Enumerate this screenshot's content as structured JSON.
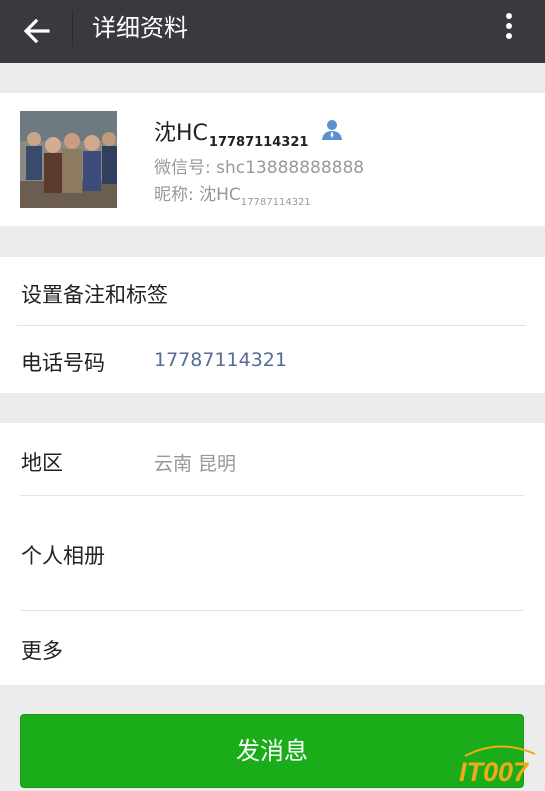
{
  "header": {
    "title": "详细资料",
    "back_icon": "arrow-left-icon",
    "more_icon": "more-vert-icon"
  },
  "profile": {
    "name": "沈HC",
    "name_suffix": "17787114321",
    "wechat_id_label": "微信号: ",
    "wechat_id": "shc13888888888",
    "nickname_label": "昵称: ",
    "nickname": "沈HC",
    "nickname_suffix": "17787114321",
    "contact_icon": "contact-person-icon"
  },
  "rows": {
    "remarks_label": "设置备注和标签",
    "phone_label": "电话号码",
    "phone_value": "17787114321",
    "region_label": "地区",
    "region_value": "云南  昆明",
    "album_label": "个人相册",
    "more_label": "更多"
  },
  "actions": {
    "send_message": "发消息"
  },
  "watermark": {
    "text": "IT007"
  },
  "colors": {
    "header_bg": "#393a3f",
    "accent_green": "#1aad19",
    "link_blue": "#576b95",
    "secondary_text": "#999999",
    "contact_icon": "#5a8fd0",
    "watermark_orange": "#f3a91c"
  }
}
